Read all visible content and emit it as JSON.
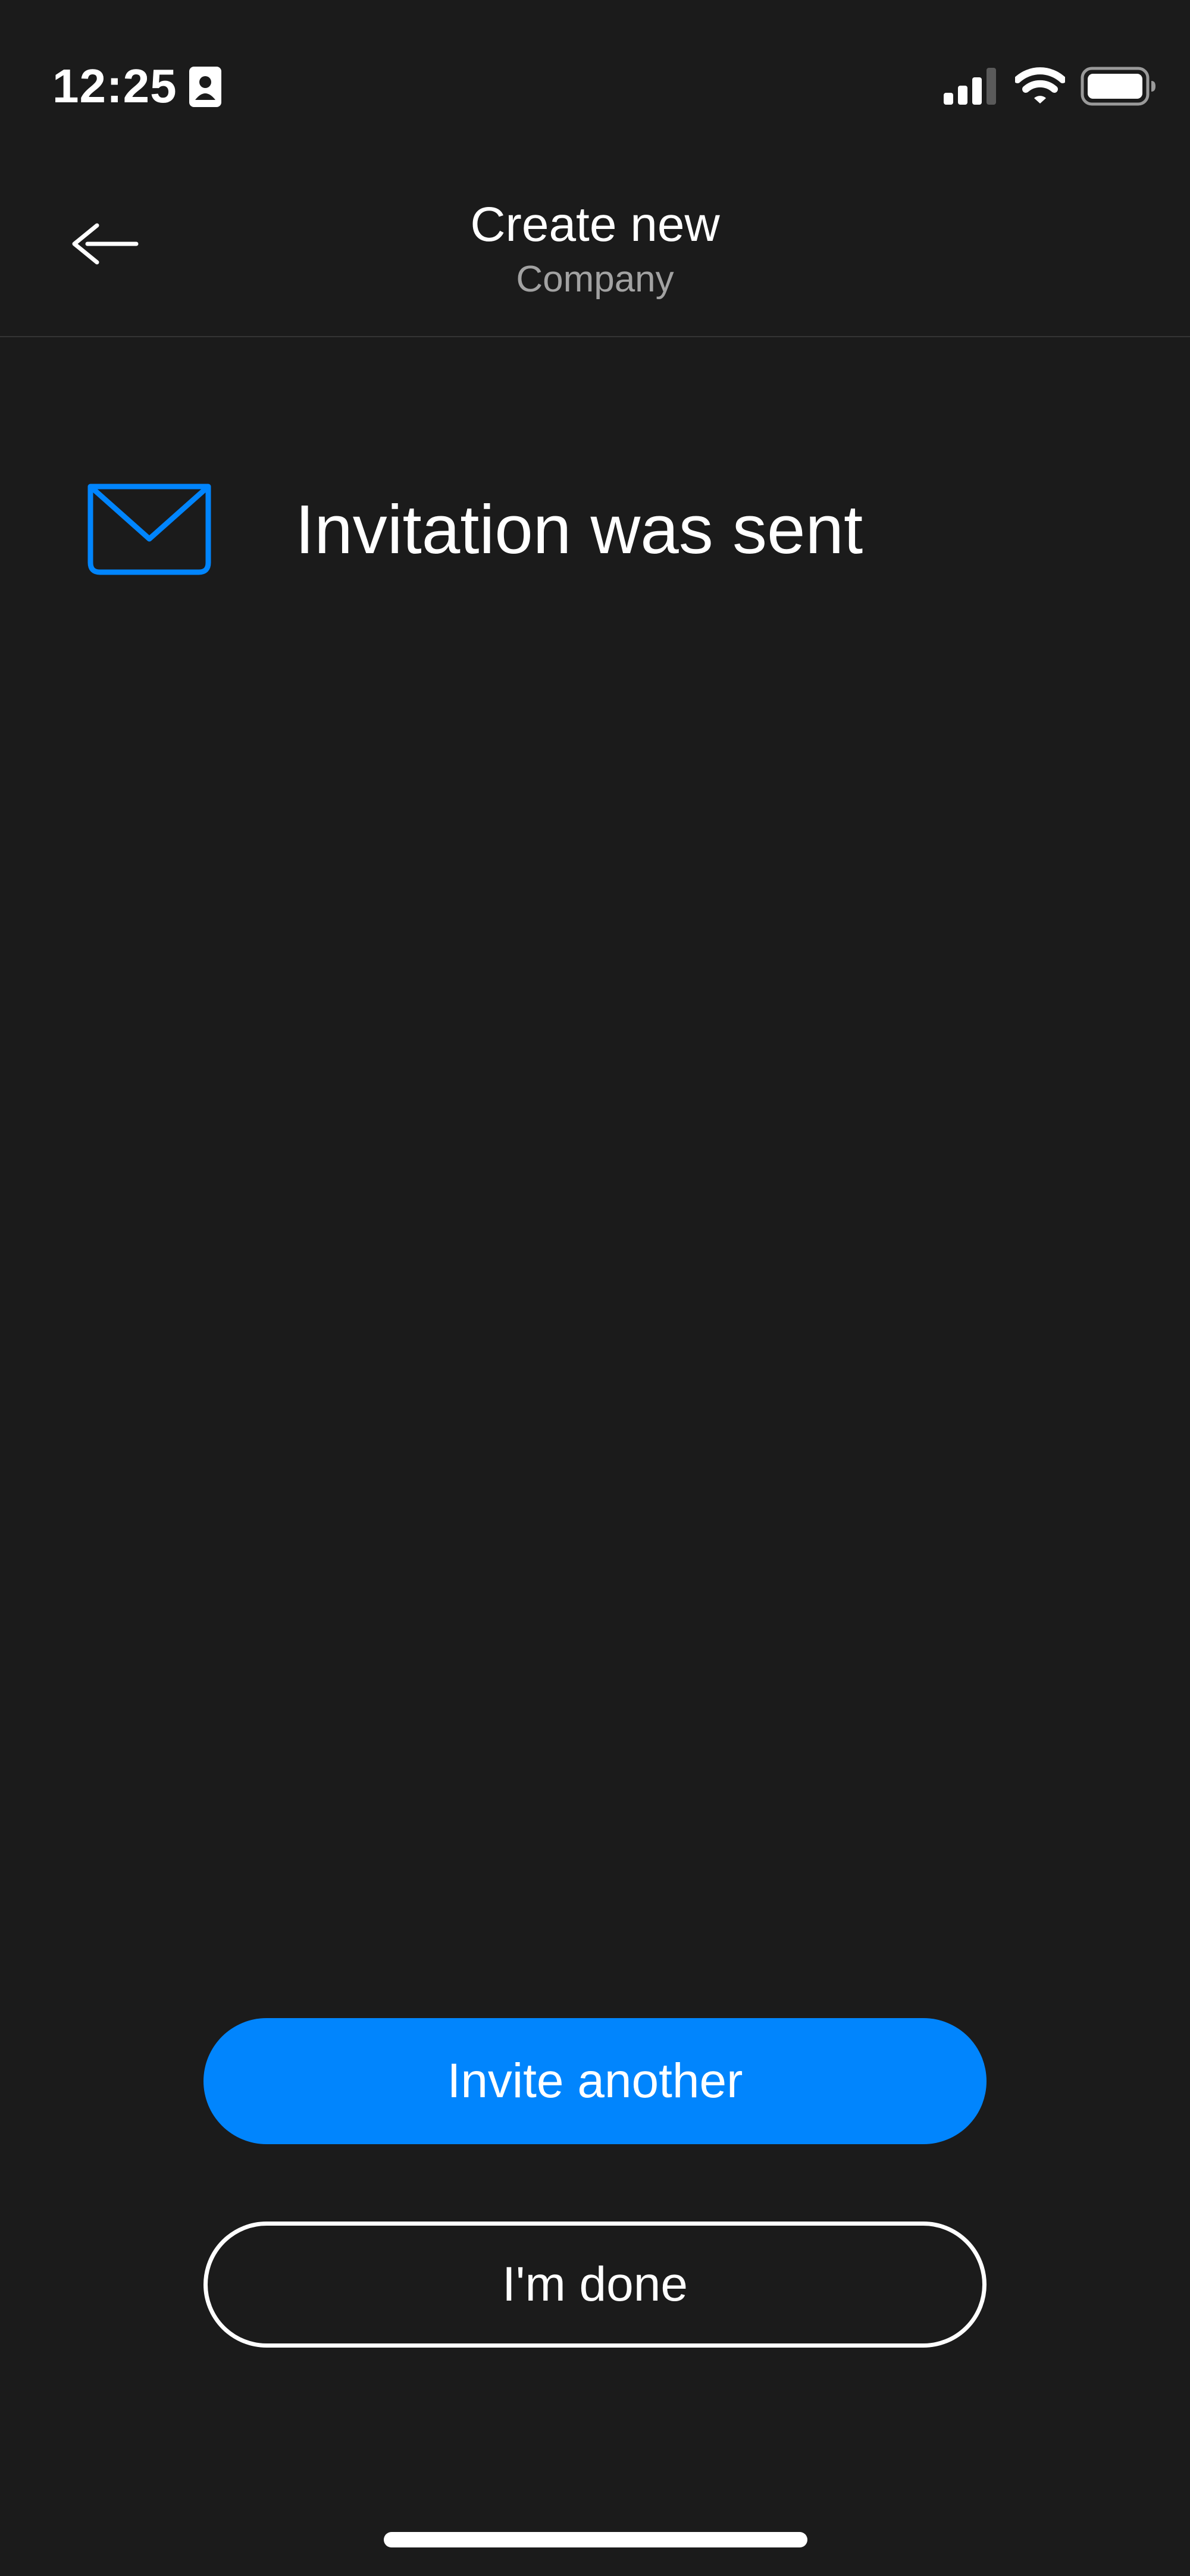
{
  "status_bar": {
    "time": "12:25",
    "icons": [
      "contact-card-icon",
      "signal-icon",
      "wifi-icon",
      "battery-icon"
    ]
  },
  "header": {
    "back_icon": "back-arrow-icon",
    "title": "Create new",
    "subtitle": "Company"
  },
  "message": {
    "icon": "mail-icon",
    "text": "Invitation was sent"
  },
  "actions": {
    "invite_another_label": "Invite another",
    "done_label": "I'm done"
  },
  "colors": {
    "background": "#1b1b1b",
    "accent": "#0185fd",
    "subtitle_text": "#a2a2a2",
    "divider": "#343434"
  }
}
